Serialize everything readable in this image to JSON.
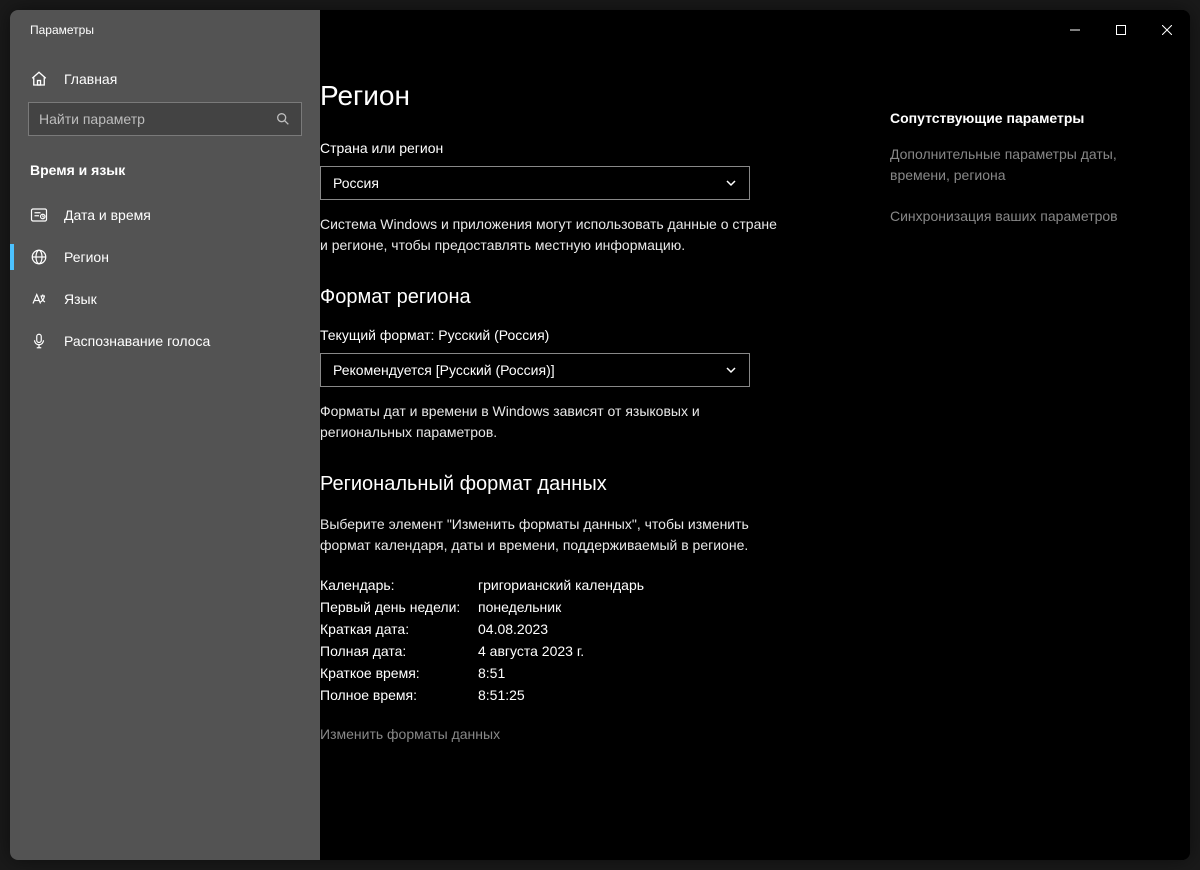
{
  "window": {
    "title": "Параметры"
  },
  "sidebar": {
    "home": "Главная",
    "search_placeholder": "Найти параметр",
    "category": "Время и язык",
    "items": [
      {
        "label": "Дата и время",
        "icon": "clock-text-icon"
      },
      {
        "label": "Регион",
        "icon": "globe-icon",
        "selected": true
      },
      {
        "label": "Язык",
        "icon": "language-icon"
      },
      {
        "label": "Распознавание голоса",
        "icon": "microphone-icon"
      }
    ]
  },
  "page": {
    "title": "Регион",
    "country_label": "Страна или регион",
    "country_value": "Россия",
    "country_help": "Система Windows и приложения могут использовать данные о стране и регионе, чтобы предоставлять местную информацию.",
    "format_title": "Формат региона",
    "current_format_label": "Текущий формат: Русский (Россия)",
    "format_value": "Рекомендуется [Русский (Россия)]",
    "format_help": "Форматы дат и времени в Windows зависят от языковых и региональных параметров.",
    "data_title": "Региональный формат данных",
    "data_help": "Выберите элемент \"Изменить форматы данных\", чтобы изменить формат календаря, даты и времени, поддерживаемый в регионе.",
    "kv": [
      {
        "k": "Календарь:",
        "v": "григорианский календарь"
      },
      {
        "k": "Первый день недели:",
        "v": "понедельник"
      },
      {
        "k": "Краткая дата:",
        "v": "04.08.2023"
      },
      {
        "k": "Полная дата:",
        "v": "4 августа 2023 г."
      },
      {
        "k": "Краткое время:",
        "v": "8:51"
      },
      {
        "k": "Полное время:",
        "v": "8:51:25"
      }
    ],
    "change_link": "Изменить форматы данных"
  },
  "aside": {
    "title": "Сопутствующие параметры",
    "links": [
      "Дополнительные параметры даты, времени, региона",
      "Синхронизация ваших параметров"
    ]
  }
}
